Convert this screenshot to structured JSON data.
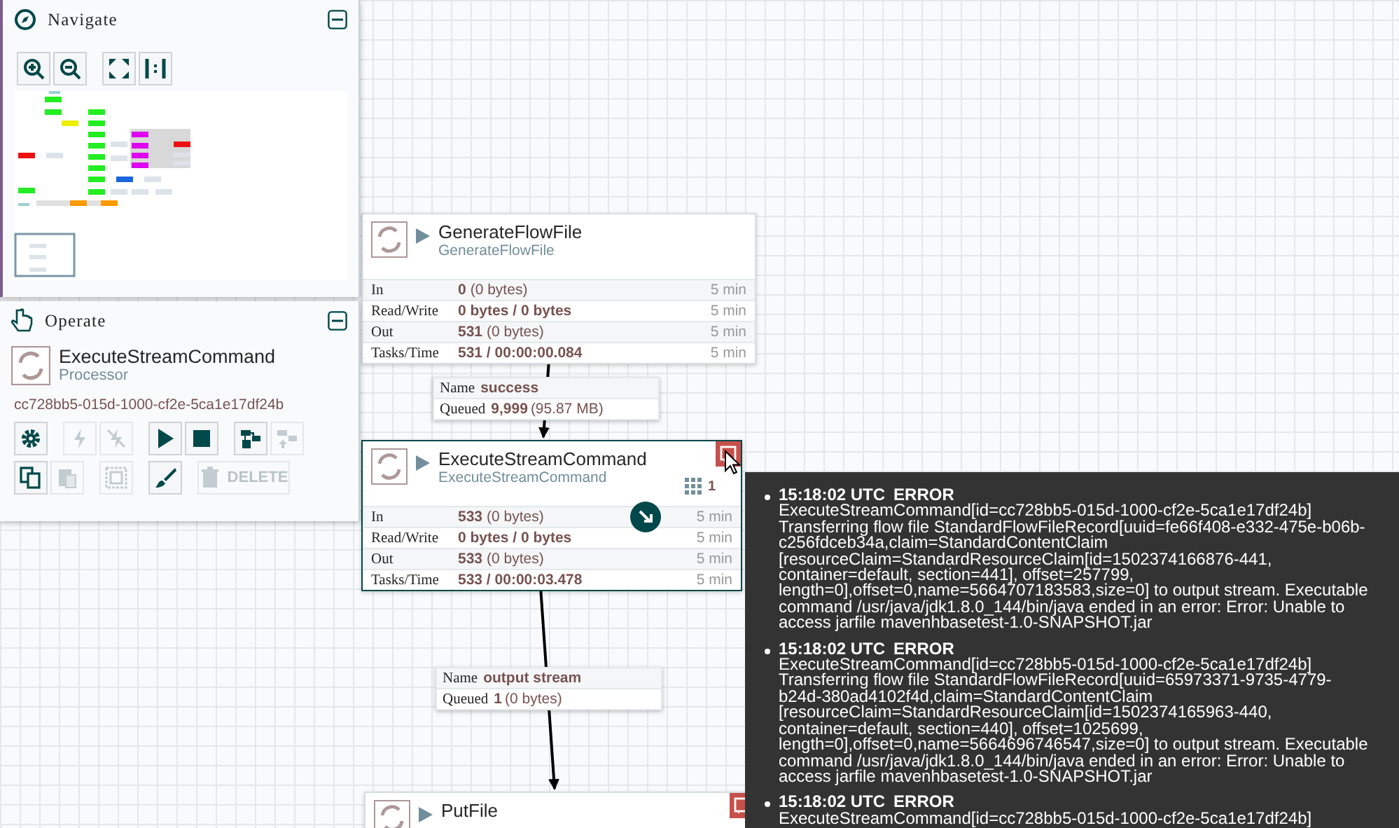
{
  "navigate": {
    "title": "Navigate",
    "buttons": [
      {
        "kind": "zoom_in"
      },
      {
        "kind": "zoom_out"
      },
      {
        "kind": "fit"
      },
      {
        "kind": "actual_size"
      }
    ]
  },
  "operate": {
    "title": "Operate",
    "component": {
      "name": "ExecuteStreamCommand",
      "type": "Processor"
    },
    "id": "cc728bb5-015d-1000-cf2e-5ca1e17df24b",
    "toolbar_rows": [
      [
        [
          {
            "kind": "configure",
            "disabled": false
          }
        ],
        [
          {
            "kind": "enable",
            "disabled": true
          },
          {
            "kind": "disable",
            "disabled": true
          }
        ],
        [
          {
            "kind": "start",
            "disabled": false
          },
          {
            "kind": "stop",
            "disabled": false
          }
        ],
        [
          {
            "kind": "create_template",
            "disabled": false
          },
          {
            "kind": "upload_template",
            "disabled": true
          }
        ]
      ],
      [
        [
          {
            "kind": "copy",
            "disabled": false
          },
          {
            "kind": "paste",
            "disabled": true
          }
        ],
        [
          {
            "kind": "group",
            "disabled": true
          }
        ],
        [
          {
            "kind": "color",
            "disabled": false
          }
        ],
        [
          {
            "kind": "delete",
            "label": "DELETE",
            "disabled": true
          }
        ]
      ]
    ]
  },
  "processors": [
    {
      "name": "GenerateFlowFile",
      "type": "GenerateFlowFile",
      "selected": false,
      "has_bulletins": false,
      "stats": [
        {
          "label": "In",
          "value": "0",
          "detail": "(0 bytes)",
          "period": "5 min"
        },
        {
          "label": "Read/Write",
          "value": "0 bytes / 0 bytes",
          "period": "5 min"
        },
        {
          "label": "Out",
          "value": "531",
          "detail": "(0 bytes)",
          "period": "5 min"
        },
        {
          "label": "Tasks/Time",
          "value": "531 / 00:00:00.084",
          "period": "5 min"
        }
      ]
    },
    {
      "name": "ExecuteStreamCommand",
      "type": "ExecuteStreamCommand",
      "selected": true,
      "has_bulletins": true,
      "active_threads": "1",
      "stats": [
        {
          "label": "In",
          "value": "533",
          "detail": "(0 bytes)",
          "period": "5 min"
        },
        {
          "label": "Read/Write",
          "value": "0 bytes / 0 bytes",
          "period": "5 min"
        },
        {
          "label": "Out",
          "value": "533",
          "detail": "(0 bytes)",
          "period": "5 min"
        },
        {
          "label": "Tasks/Time",
          "value": "533 / 00:00:03.478",
          "period": "5 min"
        }
      ]
    },
    {
      "name": "PutFile",
      "selected": false,
      "has_bulletins": true
    }
  ],
  "connections": [
    {
      "name_label": "Name",
      "name": "success",
      "queued_label": "Queued",
      "queued": "9,999",
      "queued_size": "(95.87 MB)"
    },
    {
      "name_label": "Name",
      "name": "output stream",
      "queued_label": "Queued",
      "queued": "1",
      "queued_size": "(0 bytes)"
    }
  ],
  "bulletins": [
    {
      "time": "15:18:02 UTC",
      "level": "ERROR",
      "message": "ExecuteStreamCommand[id=cc728bb5-015d-1000-cf2e-5ca1e17df24b] Transferring flow file StandardFlowFileRecord[uuid=fe66f408-e332-475e-b06b-c256fdceb34a,claim=StandardContentClaim [resourceClaim=StandardResourceClaim[id=1502374166876-441, container=default, section=441], offset=257799, length=0],offset=0,name=5664707183583,size=0] to output stream. Executable command /usr/java/jdk1.8.0_144/bin/java ended in an error: Error: Unable to access jarfile mavenhbasetest-1.0-SNAPSHOT.jar"
    },
    {
      "time": "15:18:02 UTC",
      "level": "ERROR",
      "message": "ExecuteStreamCommand[id=cc728bb5-015d-1000-cf2e-5ca1e17df24b] Transferring flow file StandardFlowFileRecord[uuid=65973371-9735-4779-b24d-380ad4102f4d,claim=StandardContentClaim [resourceClaim=StandardResourceClaim[id=1502374165963-440, container=default, section=440], offset=1025699, length=0],offset=0,name=5664696746547,size=0] to output stream. Executable command /usr/java/jdk1.8.0_144/bin/java ended in an error: Error: Unable to access jarfile mavenhbasetest-1.0-SNAPSHOT.jar"
    },
    {
      "time": "15:18:02 UTC",
      "level": "ERROR",
      "message": "ExecuteStreamCommand[id=cc728bb5-015d-1000-cf2e-5ca1e17df24b]"
    }
  ]
}
